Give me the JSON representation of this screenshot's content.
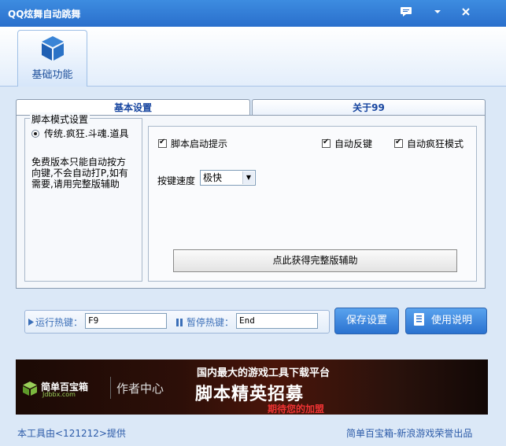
{
  "window": {
    "title": "QQ炫舞自动跳舞",
    "icons": [
      "chat-icon",
      "dropdown-icon",
      "close-icon"
    ]
  },
  "ribbon": {
    "tab_label": "基础功能",
    "tab_icon": "cube-icon"
  },
  "tabs": [
    {
      "label": "基本设置",
      "active": true
    },
    {
      "label": "关于99",
      "active": false
    }
  ],
  "mode_group": {
    "title": "脚本模式设置",
    "selected_option": "传统.疯狂.斗魂.道具",
    "notice": "免费版本只能自动按方向键,不会自动打P,如有需要,请用完整版辅助"
  },
  "options": {
    "startup_hint": {
      "label": "脚本启动提示",
      "checked": true
    },
    "auto_counter": {
      "label": "自动反键",
      "checked": true
    },
    "auto_crazy": {
      "label": "自动疯狂模式",
      "checked": true
    }
  },
  "speed": {
    "label": "按键速度",
    "value": "极快"
  },
  "get_full_button": "点此获得完整版辅助",
  "hotkeys": {
    "run_label": "运行热键：",
    "run_value": "F9",
    "pause_label": "暂停热键：",
    "pause_value": "End"
  },
  "buttons": {
    "save": "保存设置",
    "help": "使用说明"
  },
  "banner": {
    "logo_text": "简单百宝箱",
    "logo_sub": "Jdbbx.com",
    "center_text": "作者中心",
    "headline_small": "国内最大的游戏工具下载平台",
    "headline_big": "脚本精英招募",
    "headline_sub": "期待您的加盟"
  },
  "footer": {
    "left": "本工具由<121212>提供",
    "right": "简单百宝箱-新浪游戏荣誉出品"
  }
}
